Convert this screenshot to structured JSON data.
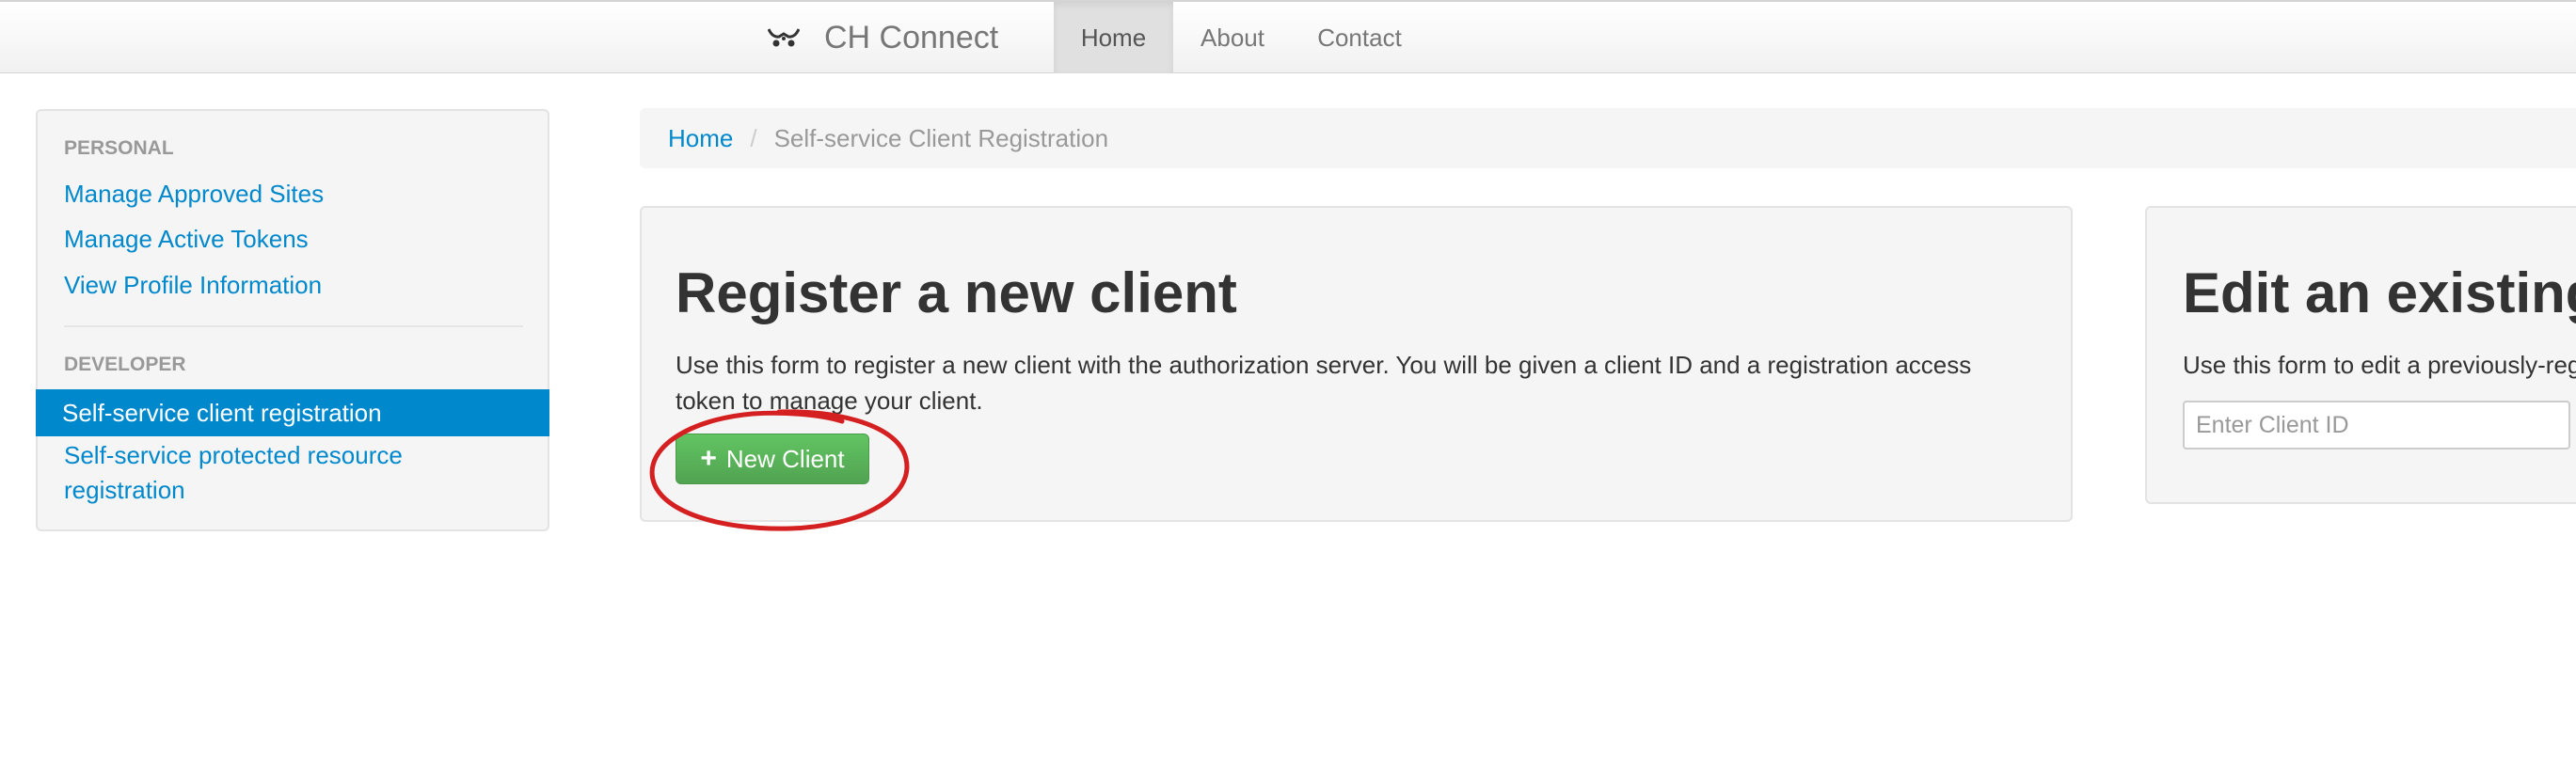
{
  "navbar": {
    "brand": "CH Connect",
    "items": [
      {
        "label": "Home"
      },
      {
        "label": "About"
      },
      {
        "label": "Contact"
      }
    ]
  },
  "sidebar": {
    "personal_header": "PERSONAL",
    "personal_links": [
      {
        "label": "Manage Approved Sites"
      },
      {
        "label": "Manage Active Tokens"
      },
      {
        "label": "View Profile Information"
      }
    ],
    "developer_header": "DEVELOPER",
    "developer_links": [
      {
        "label": "Self-service client registration"
      },
      {
        "label_line1": "Self-service protected resource",
        "label_line2": "registration"
      }
    ]
  },
  "breadcrumb": {
    "home": "Home",
    "separator": "/",
    "current": "Self-service Client Registration"
  },
  "register": {
    "title": "Register a new client",
    "description_line1": "Use this form to register a new client with the authorization server. You will be given a client ID and a registration access",
    "description_line2": "token to manage your client.",
    "button_label": "New Client",
    "button_icon": "plus-icon"
  },
  "edit": {
    "title": "Edit an existing",
    "description": "Use this form to edit a previously-reg",
    "input_placeholder": "Enter Client ID"
  },
  "colors": {
    "link": "#0088cc",
    "active": "#0088cc",
    "success": "#5bb75b",
    "annotation": "#d42020"
  }
}
